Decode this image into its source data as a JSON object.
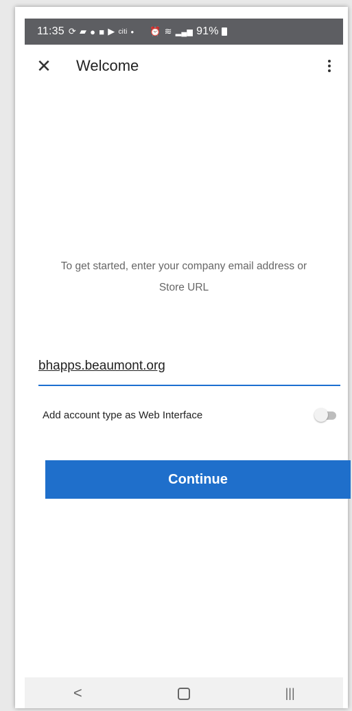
{
  "status_bar": {
    "time": "11:35",
    "battery": "91%",
    "icons": [
      "sync-icon",
      "chat-icon",
      "facebook-icon",
      "teams-icon",
      "youtube-icon",
      "citi-icon",
      "dot-icon",
      "alarm-icon",
      "wifi-icon",
      "signal-icon",
      "battery-icon"
    ]
  },
  "app_bar": {
    "title": "Welcome",
    "close_icon": "close-icon",
    "menu_icon": "more-vert-icon"
  },
  "form": {
    "prompt_line1": "To get started, enter your company email address or",
    "prompt_line2": "Store URL",
    "url_value": "bhapps.beaumont.org",
    "toggle_label": "Add account type as Web Interface",
    "toggle_on": false,
    "continue_label": "Continue"
  },
  "nav_bar": {
    "back": "<",
    "recents": "|||"
  },
  "colors": {
    "accent": "#1f6fcb",
    "status_bar": "#5d5e62"
  }
}
